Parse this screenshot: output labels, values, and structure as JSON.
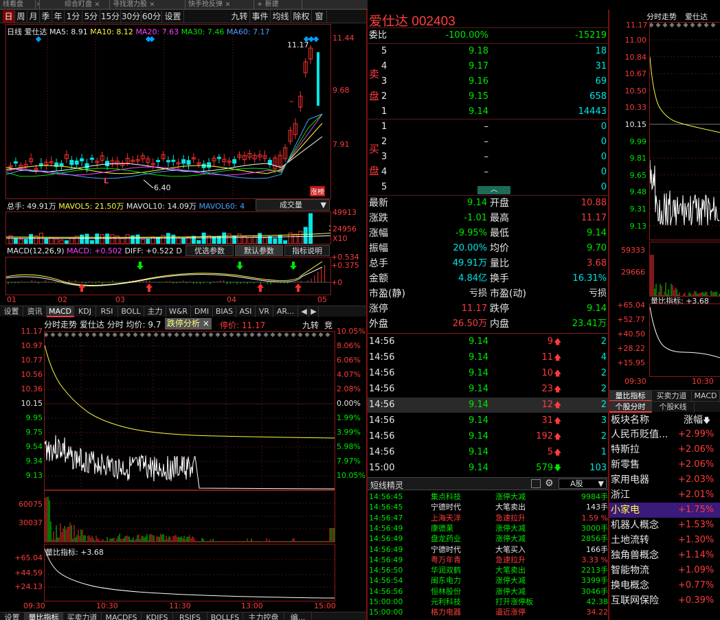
{
  "window": {
    "tabs": [
      "线看盘",
      "综合盯盘",
      "寻找潜力股",
      "快手抢反弹",
      "新建"
    ],
    "close_glyph": "×",
    "plus_glyph": "+"
  },
  "periods": {
    "items": [
      "日",
      "周",
      "月",
      "季",
      "年",
      "1分",
      "5分",
      "15分",
      "30分",
      "60分",
      "设置"
    ],
    "right": [
      "九转",
      "事件",
      "均线",
      "除权",
      "窗"
    ]
  },
  "kline": {
    "ma_line": {
      "label": "日线",
      "name": "爱仕达",
      "ma5": "MA5: 8.91",
      "ma10": "MA10: 8.12",
      "ma20": "MA20: 7.63",
      "ma30": "MA30: 7.46",
      "ma60": "MA60: 7.17"
    },
    "yaxis": [
      "11.44",
      "9.68",
      "7.91"
    ],
    "high_label": "11.17",
    "low_label": "6.40",
    "l_marker": "L",
    "badge": "涨榜",
    "vol_line": {
      "total": "总手: 49.91万",
      "mavol5": "MAVOL5: 21.50万",
      "mavol10": "MAVOL10: 14.09万",
      "mavol60": "MAVOL60: 4"
    },
    "vol_select": "成交量",
    "vol_axis": [
      "49913",
      "24956",
      "X10"
    ],
    "macd_line": {
      "params": "MACD(12,26,9)",
      "macd": "MACD: +0.502",
      "diff": "DIFF: +0.522",
      "d": "D"
    },
    "macd_buttons": [
      "优选参数",
      "默认参数",
      "指标说明"
    ],
    "macd_axis": [
      "+0.534",
      "+0.375",
      "+0"
    ],
    "xaxis": [
      "01",
      "02",
      "03",
      "04",
      "05"
    ]
  },
  "ind_tabs": [
    "设置",
    "资讯",
    "MACD",
    "KDJ",
    "RSI",
    "BOLL",
    "主力",
    "W&R",
    "DMI",
    "BIAS",
    "ASI",
    "VR",
    "AR..."
  ],
  "arrows": {
    "left": "◀",
    "right": "▶"
  },
  "intraday": {
    "title_bar": {
      "label": "分时走势",
      "name": "爱仕达",
      "fen": "分时",
      "avg": "均价: 9.7",
      "limit_btn": "跌停分析",
      "limit_close": "×",
      "limit_price": "停价: 11.17",
      "jiuzhuan": "九转",
      "jing": "竞"
    },
    "left_axis": [
      "11.17",
      "10.97",
      "10.77",
      "10.56",
      "10.36",
      "10.15",
      "9.95",
      "9.75",
      "9.54",
      "9.34",
      "9.13"
    ],
    "right_axis": [
      "10.05%",
      "8.06%",
      "6.06%",
      "4.07%",
      "2.08%",
      "0.00%",
      "1.99%",
      "3.99%",
      "5.98%",
      "7.97%",
      "10.05%"
    ],
    "vol_axis": [
      "60075",
      "30037"
    ],
    "ratio_label": "量比指标: +3.68",
    "ratio_axis": [
      "+65.04",
      "+44.59",
      "+24.13"
    ],
    "times": [
      "09:30",
      "10:30",
      "11:30",
      "13:00",
      "15:00"
    ]
  },
  "bottom_tabs": [
    "设置",
    "量比指标",
    "买卖力道",
    "MACDFS",
    "KDJFS",
    "RSIFS",
    "BOLLFS",
    "主力控盘",
    "编..."
  ],
  "quote": {
    "name": "爱仕达",
    "code": "002403",
    "weibi": {
      "label": "委比",
      "pct": "-100.00%",
      "diff": "-15219"
    },
    "sell_label": [
      "卖",
      "盘"
    ],
    "buy_label": [
      "买",
      "盘"
    ],
    "sells": [
      {
        "n": "5",
        "p": "9.18",
        "v": "18"
      },
      {
        "n": "4",
        "p": "9.17",
        "v": "31"
      },
      {
        "n": "3",
        "p": "9.16",
        "v": "69"
      },
      {
        "n": "2",
        "p": "9.15",
        "v": "658"
      },
      {
        "n": "1",
        "p": "9.14",
        "v": "14443"
      }
    ],
    "buys": [
      {
        "n": "1",
        "p": "–",
        "v": "0"
      },
      {
        "n": "2",
        "p": "–",
        "v": "0"
      },
      {
        "n": "3",
        "p": "–",
        "v": "0"
      },
      {
        "n": "4",
        "p": "–",
        "v": "0"
      },
      {
        "n": "5",
        "p": "–",
        "v": "0"
      }
    ],
    "expand": "︿",
    "stats": [
      {
        "l1": "最新",
        "v1": "9.14",
        "l2": "开盘",
        "v2": "10.88"
      },
      {
        "l1": "涨跌",
        "v1": "-1.01",
        "l2": "最高",
        "v2": "11.17"
      },
      {
        "l1": "涨幅",
        "v1": "-9.95%",
        "l2": "最低",
        "v2": "9.14"
      },
      {
        "l1": "振幅",
        "v1": "20.00%",
        "l2": "均价",
        "v2": "9.70"
      },
      {
        "l1": "总手",
        "v1": "49.91万",
        "l2": "量比",
        "v2": "3.68"
      },
      {
        "l1": "金额",
        "v1": "4.84亿",
        "l2": "换手",
        "v2": "16.31%"
      },
      {
        "l1": "市盈(静)",
        "v1": "亏损",
        "l2": "市盈(动)",
        "v2": "亏损"
      },
      {
        "l1": "涨停",
        "v1": "11.17",
        "l2": "跌停",
        "v2": "9.14"
      },
      {
        "l1": "外盘",
        "v1": "26.50万",
        "l2": "内盘",
        "v2": "23.41万"
      }
    ]
  },
  "ticks": [
    {
      "t": "14:56",
      "p": "9.14",
      "v": "9",
      "d": "up",
      "c": "2"
    },
    {
      "t": "14:56",
      "p": "9.14",
      "v": "11",
      "d": "up",
      "c": "4"
    },
    {
      "t": "14:56",
      "p": "9.14",
      "v": "10",
      "d": "up",
      "c": "2"
    },
    {
      "t": "14:56",
      "p": "9.14",
      "v": "23",
      "d": "up",
      "c": "2"
    },
    {
      "t": "14:56",
      "p": "9.14",
      "v": "12",
      "d": "up",
      "c": "2"
    },
    {
      "t": "14:56",
      "p": "9.14",
      "v": "31",
      "d": "up",
      "c": "3"
    },
    {
      "t": "14:56",
      "p": "9.14",
      "v": "192",
      "d": "up",
      "c": "2"
    },
    {
      "t": "14:56",
      "p": "9.14",
      "v": "5",
      "d": "up",
      "c": "1"
    },
    {
      "t": "15:00",
      "p": "9.14",
      "v": "579",
      "d": "down",
      "c": "103"
    }
  ],
  "elf": {
    "title": "短线精灵",
    "select": "A股",
    "rows": [
      {
        "t": "14:56:45",
        "n": "集点科技",
        "e": "涨停大减",
        "v": "9984手",
        "c": "g"
      },
      {
        "t": "14:56:45",
        "n": "宁德时代",
        "e": "大笔卖出",
        "v": "143手",
        "c": "w"
      },
      {
        "t": "14:56:47",
        "n": "上海天洋",
        "e": "急速拉升",
        "v": "1.59 %",
        "c": "r"
      },
      {
        "t": "14:56:49",
        "n": "康德莱",
        "e": "涨停大减",
        "v": "3000手",
        "c": "g"
      },
      {
        "t": "14:56:49",
        "n": "盘龙药业",
        "e": "涨停大减",
        "v": "2856手",
        "c": "g"
      },
      {
        "t": "14:56:49",
        "n": "宁德时代",
        "e": "大笔买入",
        "v": "166手",
        "c": "w"
      },
      {
        "t": "14:56:49",
        "n": "粤万年青",
        "e": "急速拉升",
        "v": "3.33 %",
        "c": "r"
      },
      {
        "t": "14:56:50",
        "n": "华润双鹤",
        "e": "大笔卖出",
        "v": "2213手",
        "c": "g"
      },
      {
        "t": "14:56:54",
        "n": "闽东电力",
        "e": "涨停大减",
        "v": "3399手",
        "c": "g"
      },
      {
        "t": "14:56:56",
        "n": "恒林股份",
        "e": "涨停大减",
        "v": "3046手",
        "c": "g"
      },
      {
        "t": "15:00:00",
        "n": "元利科技",
        "e": "打开涨停板",
        "v": "42.38",
        "c": "g"
      },
      {
        "t": "15:00:00",
        "n": "格力电器",
        "e": "逼近涨停",
        "v": "34.22",
        "c": "r"
      }
    ]
  },
  "mini": {
    "tabs": [
      "分时走势",
      "爱仕达"
    ],
    "top": "11.17",
    "axis": [
      "11.00",
      "10.84",
      "10.67",
      "10.50",
      "10.33",
      "10.15",
      "9.99",
      "9.81",
      "9.65",
      "9.48",
      "9.31",
      "9.13"
    ],
    "vol_axis": [
      "59333",
      "29666"
    ],
    "ratio_label": "量比指标: +3.68",
    "ratio_axis": [
      "+65.04",
      "+52.77",
      "+40.50",
      "+28.22",
      "+15.95"
    ],
    "times": [
      "09:30",
      "10:30"
    ]
  },
  "rtabs1": [
    "量比指标",
    "买卖力道",
    "MACD"
  ],
  "rtabs2": [
    "个股分时",
    "个股K线"
  ],
  "sectors": {
    "head_name": "板块名称",
    "head_pct": "涨幅",
    "sort_icon": "🡇",
    "items": [
      {
        "n": "人民币贬值...",
        "p": "+2.99%"
      },
      {
        "n": "特斯拉",
        "p": "+2.06%"
      },
      {
        "n": "新零售",
        "p": "+2.06%"
      },
      {
        "n": "家用电器",
        "p": "+2.03%"
      },
      {
        "n": "浙江",
        "p": "+2.01%"
      },
      {
        "n": "小家电",
        "p": "+1.75%",
        "sel": true
      },
      {
        "n": "机器人概念",
        "p": "+1.53%"
      },
      {
        "n": "土地流转",
        "p": "+1.30%"
      },
      {
        "n": "独角兽概念",
        "p": "+1.14%"
      },
      {
        "n": "智能物流",
        "p": "+1.09%"
      },
      {
        "n": "换电概念",
        "p": "+0.77%"
      },
      {
        "n": "互联网保险",
        "p": "+0.39%"
      }
    ]
  }
}
